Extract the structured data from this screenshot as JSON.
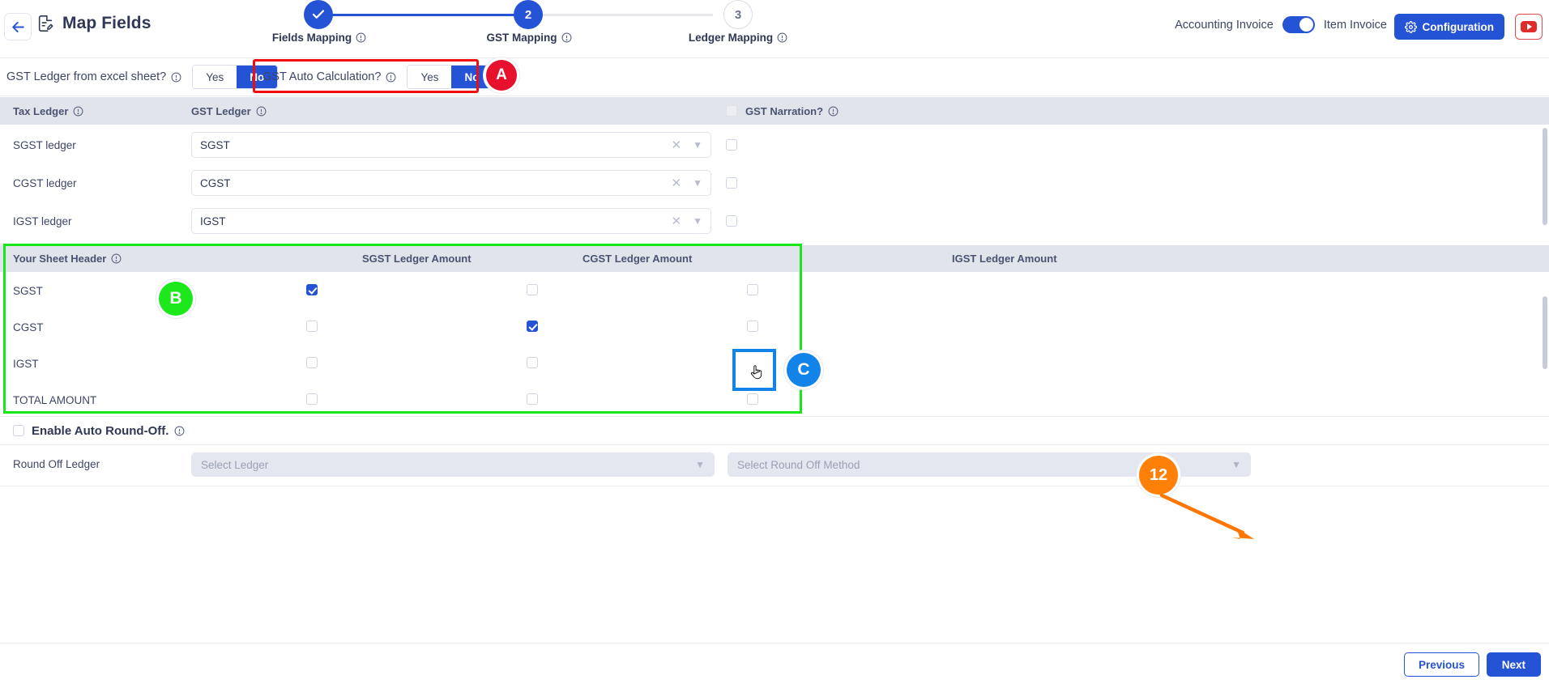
{
  "header": {
    "back_icon": "arrow-left-icon",
    "doc_icon": "document-edit-icon",
    "title": "Map Fields",
    "accounting_invoice_label": "Accounting Invoice",
    "item_invoice_label": "Item Invoice",
    "configuration_label": "Configuration",
    "gear_icon": "gear-icon",
    "youtube_icon": "youtube-icon",
    "accent_color": "#2553d6"
  },
  "stepper": {
    "steps": [
      {
        "num": "✓",
        "label": "Fields Mapping",
        "state": "done"
      },
      {
        "num": "2",
        "label": "GST Mapping",
        "state": "active"
      },
      {
        "num": "3",
        "label": "Ledger Mapping",
        "state": "todo"
      }
    ]
  },
  "questions": [
    {
      "label": "GST Ledger from excel sheet?",
      "yes": "Yes",
      "no": "No",
      "selected": "No"
    },
    {
      "label": "GST Auto Calculation?",
      "yes": "Yes",
      "no": "No",
      "selected": "No"
    }
  ],
  "annotations": [
    {
      "id": "A",
      "color": "#e8112d"
    },
    {
      "id": "B",
      "color": "#1ce81c"
    },
    {
      "id": "C",
      "color": "#1283e8"
    },
    {
      "id": "12",
      "color": "#ff8008"
    }
  ],
  "tax_table": {
    "columns": [
      "Tax Ledger",
      "GST Ledger",
      "GST Narration?"
    ],
    "narration_header_checked": false,
    "rows": [
      {
        "label": "SGST ledger",
        "ledger_value": "SGST",
        "narration": false
      },
      {
        "label": "CGST ledger",
        "ledger_value": "CGST",
        "narration": false
      },
      {
        "label": "IGST ledger",
        "ledger_value": "IGST",
        "narration": false
      }
    ],
    "clear_icon": "close-icon",
    "chevron_icon": "chevron-down-icon"
  },
  "amount_matrix": {
    "columns": [
      "Your Sheet Header",
      "SGST Ledger Amount",
      "CGST Ledger Amount",
      "IGST Ledger Amount"
    ],
    "rows": [
      {
        "label": "SGST",
        "sgst": true,
        "cgst": false,
        "igst": false
      },
      {
        "label": "CGST",
        "sgst": false,
        "cgst": true,
        "igst": false
      },
      {
        "label": "IGST",
        "sgst": false,
        "cgst": false,
        "igst": false
      },
      {
        "label": "TOTAL AMOUNT",
        "sgst": false,
        "cgst": false,
        "igst": false
      }
    ]
  },
  "round_off": {
    "enable_label": "Enable Auto Round-Off.",
    "enabled": false,
    "ledger_label": "Round Off Ledger",
    "ledger_placeholder": "Select Ledger",
    "method_placeholder": "Select Round Off Method"
  },
  "footer": {
    "previous_label": "Previous",
    "next_label": "Next"
  }
}
